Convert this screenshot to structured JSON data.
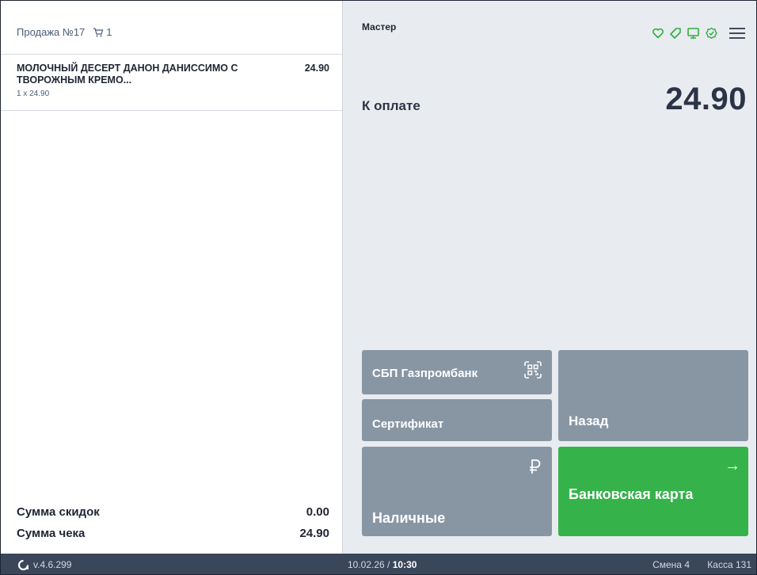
{
  "receipt": {
    "sale_title": "Продажа №17",
    "cart_count": "1",
    "items": [
      {
        "name": "МОЛОЧНЫЙ ДЕСЕРТ ДАНОН ДАНИССИМО С ТВОРОЖНЫМ КРЕМО...",
        "price": "24.90",
        "qty_line": "1 x 24.90"
      }
    ],
    "totals": {
      "discount_label": "Сумма скидок",
      "discount_value": "0.00",
      "total_label": "Сумма чека",
      "total_value": "24.90"
    }
  },
  "payment": {
    "mode": "Мастер",
    "due_label": "К оплате",
    "due_amount": "24.90",
    "buttons": {
      "sbp": "СБП Газпромбанк",
      "certificate": "Сертификат",
      "back": "Назад",
      "cash": "Наличные",
      "card": "Банковская карта",
      "card_arrow": "→"
    },
    "icons": [
      "heart-icon",
      "tag-icon",
      "monitor-icon",
      "badge-check-icon",
      "menu-icon",
      "qr-code-icon",
      "ruble-icon"
    ]
  },
  "statusbar": {
    "version": "v.4.6.299",
    "date": "10.02.26 /",
    "time": "10:30",
    "shift": "Смена 4",
    "register": "Касса 131"
  },
  "colors": {
    "accent_green": "#35b34a",
    "button_gray": "#8896a4",
    "panel_bg": "#e8ecf0",
    "statusbar_bg": "#3a4659",
    "icon_green": "#2fae3c"
  }
}
